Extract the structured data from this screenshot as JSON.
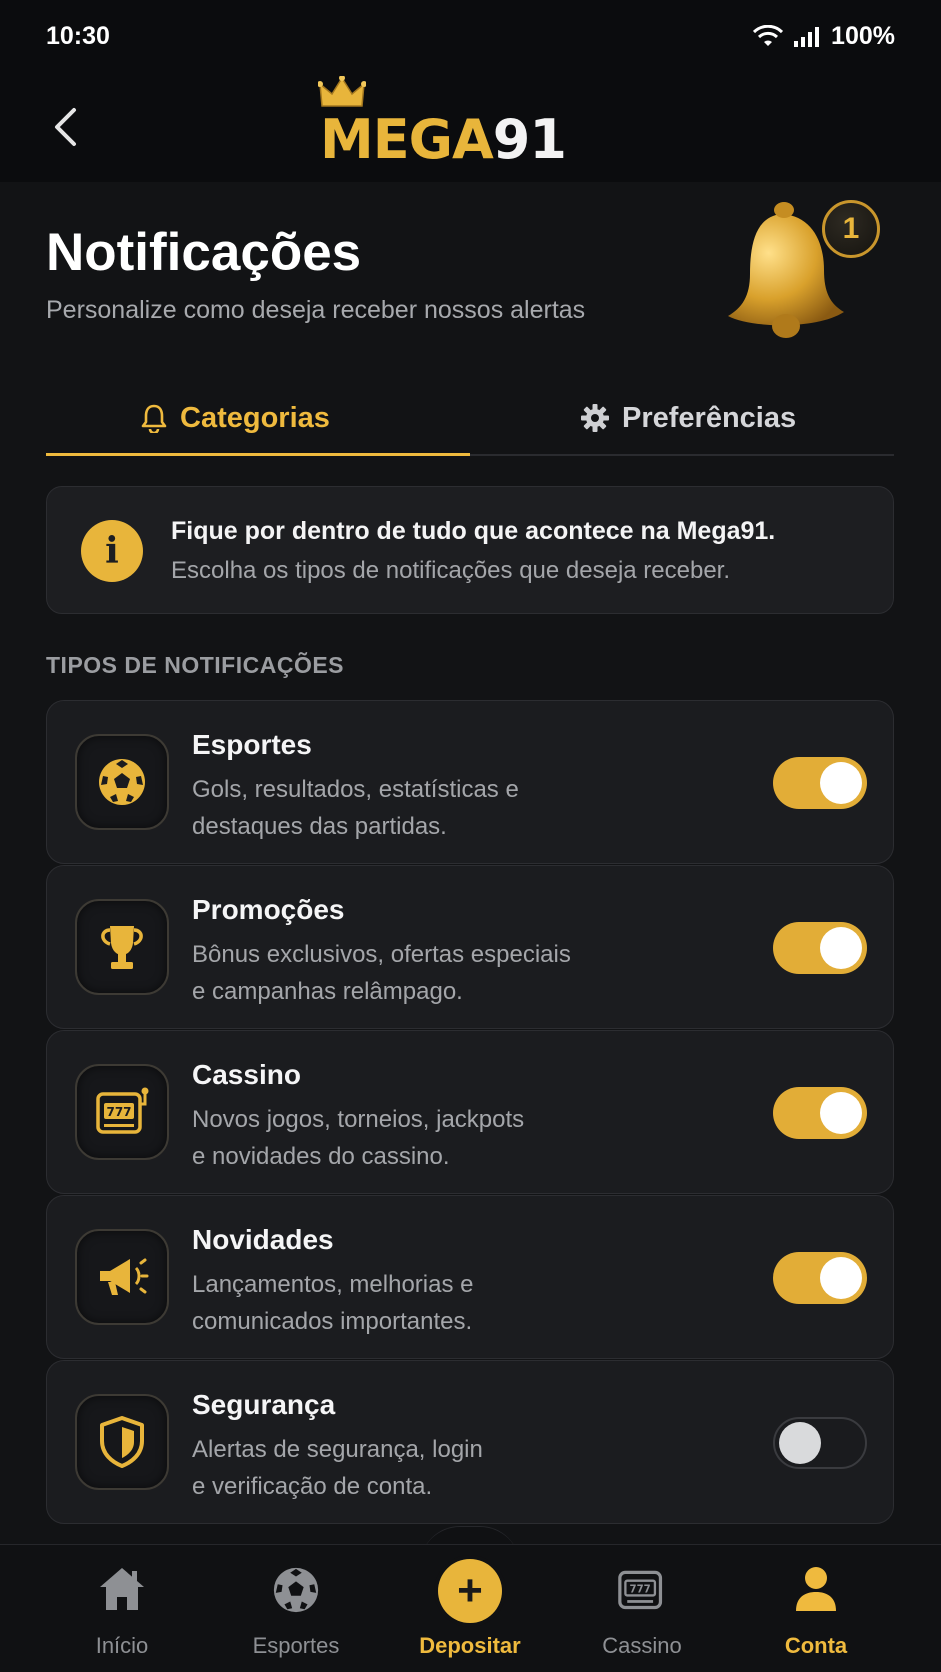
{
  "status_bar": {
    "time": "10:30",
    "battery": "100%"
  },
  "header": {
    "logo_mega": "MEGA",
    "logo_number": "91"
  },
  "page": {
    "title": "Notificações",
    "subtitle": "Personalize como deseja receber nossos alertas",
    "badge_count": "1"
  },
  "tabs": [
    {
      "label": "Categorias",
      "icon": "bell-icon",
      "active": true
    },
    {
      "label": "Preferências",
      "icon": "gear-icon",
      "active": false
    }
  ],
  "info": {
    "title": "Fique por dentro de tudo que acontece na Mega91.",
    "text": "Escolha os tipos de notificações que deseja receber."
  },
  "section_label": "TIPOS DE NOTIFICAÇÕES",
  "notifications": [
    {
      "title": "Esportes",
      "line1": "Gols, resultados, estatísticas e",
      "line2": "destaques das partidas.",
      "icon": "soccer-ball-icon",
      "enabled": true
    },
    {
      "title": "Promoções",
      "line1": "Bônus exclusivos, ofertas especiais",
      "line2": "e campanhas relâmpago.",
      "icon": "trophy-icon",
      "enabled": true
    },
    {
      "title": "Cassino",
      "line1": "Novos jogos, torneios, jackpots",
      "line2": "e novidades do cassino.",
      "icon": "slot-machine-icon",
      "enabled": true
    },
    {
      "title": "Novidades",
      "line1": "Lançamentos, melhorias e",
      "line2": "comunicados importantes.",
      "icon": "megaphone-icon",
      "enabled": true
    },
    {
      "title": "Segurança",
      "line1": "Alertas de segurança, login",
      "line2": "e verificação de conta.",
      "icon": "shield-icon",
      "enabled": false
    }
  ],
  "bottom_nav": [
    {
      "label": "Início",
      "icon": "home-icon",
      "active": false
    },
    {
      "label": "Esportes",
      "icon": "soccer-ball-icon",
      "active": false
    },
    {
      "label": "Depositar",
      "icon": "plus-icon",
      "active": true
    },
    {
      "label": "Cassino",
      "icon": "slot-machine-icon",
      "active": false
    },
    {
      "label": "Conta",
      "icon": "user-icon",
      "active": true
    }
  ],
  "colors": {
    "accent": "#e8b53b",
    "background": "#121315",
    "card": "#1b1c1f"
  }
}
